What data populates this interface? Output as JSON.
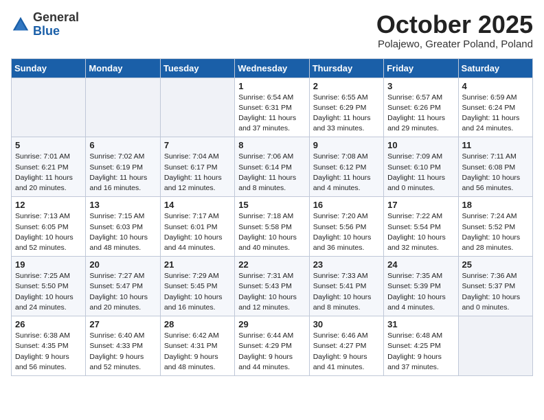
{
  "logo": {
    "general": "General",
    "blue": "Blue"
  },
  "header": {
    "month_title": "October 2025",
    "subtitle": "Polajewo, Greater Poland, Poland"
  },
  "weekdays": [
    "Sunday",
    "Monday",
    "Tuesday",
    "Wednesday",
    "Thursday",
    "Friday",
    "Saturday"
  ],
  "weeks": [
    [
      {
        "day": "",
        "info": ""
      },
      {
        "day": "",
        "info": ""
      },
      {
        "day": "",
        "info": ""
      },
      {
        "day": "1",
        "info": "Sunrise: 6:54 AM\nSunset: 6:31 PM\nDaylight: 11 hours\nand 37 minutes."
      },
      {
        "day": "2",
        "info": "Sunrise: 6:55 AM\nSunset: 6:29 PM\nDaylight: 11 hours\nand 33 minutes."
      },
      {
        "day": "3",
        "info": "Sunrise: 6:57 AM\nSunset: 6:26 PM\nDaylight: 11 hours\nand 29 minutes."
      },
      {
        "day": "4",
        "info": "Sunrise: 6:59 AM\nSunset: 6:24 PM\nDaylight: 11 hours\nand 24 minutes."
      }
    ],
    [
      {
        "day": "5",
        "info": "Sunrise: 7:01 AM\nSunset: 6:21 PM\nDaylight: 11 hours\nand 20 minutes."
      },
      {
        "day": "6",
        "info": "Sunrise: 7:02 AM\nSunset: 6:19 PM\nDaylight: 11 hours\nand 16 minutes."
      },
      {
        "day": "7",
        "info": "Sunrise: 7:04 AM\nSunset: 6:17 PM\nDaylight: 11 hours\nand 12 minutes."
      },
      {
        "day": "8",
        "info": "Sunrise: 7:06 AM\nSunset: 6:14 PM\nDaylight: 11 hours\nand 8 minutes."
      },
      {
        "day": "9",
        "info": "Sunrise: 7:08 AM\nSunset: 6:12 PM\nDaylight: 11 hours\nand 4 minutes."
      },
      {
        "day": "10",
        "info": "Sunrise: 7:09 AM\nSunset: 6:10 PM\nDaylight: 11 hours\nand 0 minutes."
      },
      {
        "day": "11",
        "info": "Sunrise: 7:11 AM\nSunset: 6:08 PM\nDaylight: 10 hours\nand 56 minutes."
      }
    ],
    [
      {
        "day": "12",
        "info": "Sunrise: 7:13 AM\nSunset: 6:05 PM\nDaylight: 10 hours\nand 52 minutes."
      },
      {
        "day": "13",
        "info": "Sunrise: 7:15 AM\nSunset: 6:03 PM\nDaylight: 10 hours\nand 48 minutes."
      },
      {
        "day": "14",
        "info": "Sunrise: 7:17 AM\nSunset: 6:01 PM\nDaylight: 10 hours\nand 44 minutes."
      },
      {
        "day": "15",
        "info": "Sunrise: 7:18 AM\nSunset: 5:58 PM\nDaylight: 10 hours\nand 40 minutes."
      },
      {
        "day": "16",
        "info": "Sunrise: 7:20 AM\nSunset: 5:56 PM\nDaylight: 10 hours\nand 36 minutes."
      },
      {
        "day": "17",
        "info": "Sunrise: 7:22 AM\nSunset: 5:54 PM\nDaylight: 10 hours\nand 32 minutes."
      },
      {
        "day": "18",
        "info": "Sunrise: 7:24 AM\nSunset: 5:52 PM\nDaylight: 10 hours\nand 28 minutes."
      }
    ],
    [
      {
        "day": "19",
        "info": "Sunrise: 7:25 AM\nSunset: 5:50 PM\nDaylight: 10 hours\nand 24 minutes."
      },
      {
        "day": "20",
        "info": "Sunrise: 7:27 AM\nSunset: 5:47 PM\nDaylight: 10 hours\nand 20 minutes."
      },
      {
        "day": "21",
        "info": "Sunrise: 7:29 AM\nSunset: 5:45 PM\nDaylight: 10 hours\nand 16 minutes."
      },
      {
        "day": "22",
        "info": "Sunrise: 7:31 AM\nSunset: 5:43 PM\nDaylight: 10 hours\nand 12 minutes."
      },
      {
        "day": "23",
        "info": "Sunrise: 7:33 AM\nSunset: 5:41 PM\nDaylight: 10 hours\nand 8 minutes."
      },
      {
        "day": "24",
        "info": "Sunrise: 7:35 AM\nSunset: 5:39 PM\nDaylight: 10 hours\nand 4 minutes."
      },
      {
        "day": "25",
        "info": "Sunrise: 7:36 AM\nSunset: 5:37 PM\nDaylight: 10 hours\nand 0 minutes."
      }
    ],
    [
      {
        "day": "26",
        "info": "Sunrise: 6:38 AM\nSunset: 4:35 PM\nDaylight: 9 hours\nand 56 minutes."
      },
      {
        "day": "27",
        "info": "Sunrise: 6:40 AM\nSunset: 4:33 PM\nDaylight: 9 hours\nand 52 minutes."
      },
      {
        "day": "28",
        "info": "Sunrise: 6:42 AM\nSunset: 4:31 PM\nDaylight: 9 hours\nand 48 minutes."
      },
      {
        "day": "29",
        "info": "Sunrise: 6:44 AM\nSunset: 4:29 PM\nDaylight: 9 hours\nand 44 minutes."
      },
      {
        "day": "30",
        "info": "Sunrise: 6:46 AM\nSunset: 4:27 PM\nDaylight: 9 hours\nand 41 minutes."
      },
      {
        "day": "31",
        "info": "Sunrise: 6:48 AM\nSunset: 4:25 PM\nDaylight: 9 hours\nand 37 minutes."
      },
      {
        "day": "",
        "info": ""
      }
    ]
  ]
}
